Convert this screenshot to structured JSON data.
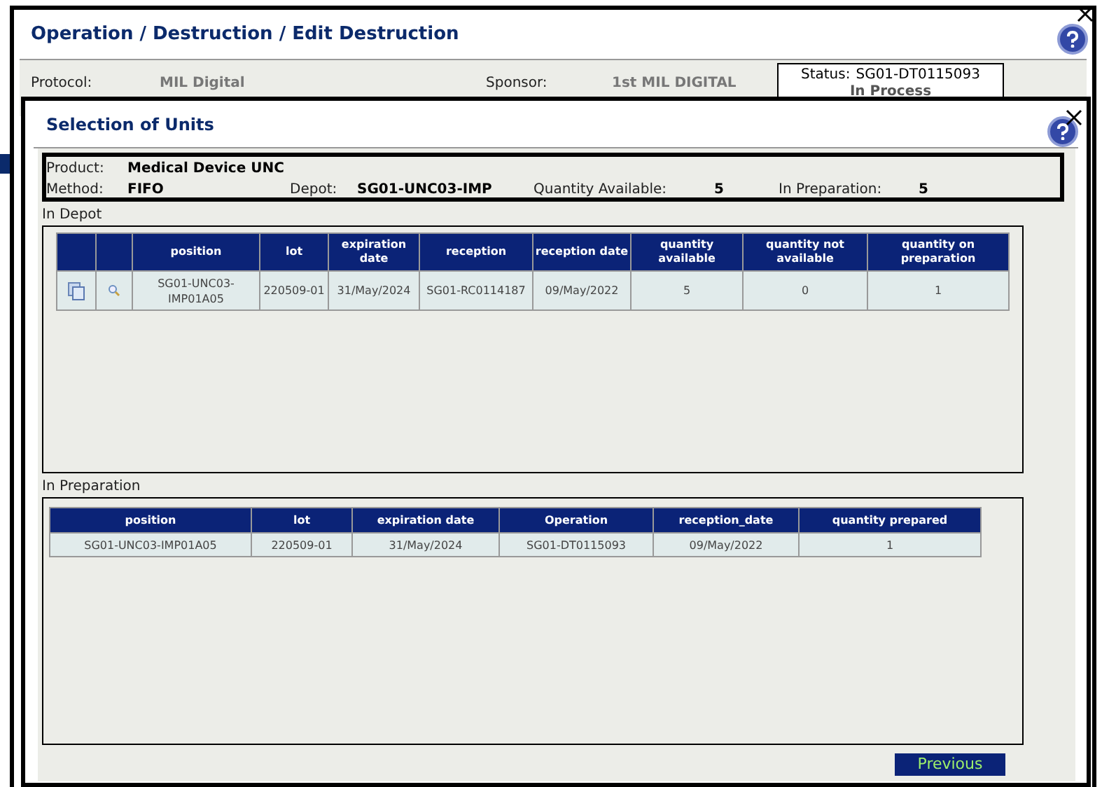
{
  "window": {
    "title": "Operation / Destruction / Edit Destruction"
  },
  "header": {
    "fields": [
      {
        "label": "Protocol:",
        "value": "MIL Digital"
      },
      {
        "label": "Sponsor:",
        "value": "1st MIL DIGITAL"
      }
    ],
    "status_label": "Status:",
    "status_value": "SG01-DT0115093",
    "status_state": "In Process"
  },
  "dialog": {
    "title": "Selection of Units",
    "summary": {
      "product_label": "Product:",
      "product": "Medical Device UNC",
      "method_label": "Method:",
      "method": "FIFO",
      "depot_label": "Depot:",
      "depot": "SG01-UNC03-IMP",
      "qty_label": "Quantity Available:",
      "qty": "5",
      "prep_label": "In Preparation:",
      "prep": "5"
    },
    "in_depot": {
      "title": "In Depot",
      "columns": [
        "position",
        "lot",
        "expiration date",
        "reception",
        "reception date",
        "quantity available",
        "quantity not available",
        "quantity on preparation"
      ],
      "rows": [
        {
          "cells": [
            "SG01-UNC03-IMP01A05",
            "220509-01",
            "31/May/2024",
            "SG01-RC0114187",
            "09/May/2022",
            "5",
            "0",
            "1"
          ]
        }
      ]
    },
    "in_preparation": {
      "title": "In Preparation",
      "columns": [
        "position",
        "lot",
        "expiration date",
        "Operation",
        "reception_date",
        "quantity prepared"
      ],
      "rows": [
        {
          "cells": [
            "SG01-UNC03-IMP01A05",
            "220509-01",
            "31/May/2024",
            "SG01-DT0115093",
            "09/May/2022",
            "1"
          ]
        }
      ]
    },
    "buttons": [
      "Previous"
    ]
  }
}
